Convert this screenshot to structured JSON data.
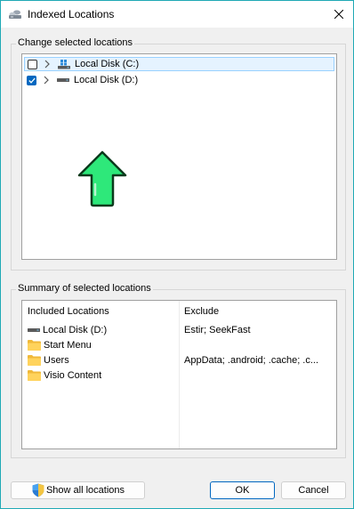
{
  "window": {
    "title": "Indexed Locations"
  },
  "change_group": {
    "label": "Change selected locations",
    "tree": [
      {
        "label": "Local Disk (C:)",
        "checked": false,
        "selected": true,
        "icon": "windows-drive-icon"
      },
      {
        "label": "Local Disk (D:)",
        "checked": true,
        "selected": false,
        "icon": "drive-icon"
      }
    ]
  },
  "summary_group": {
    "label": "Summary of selected locations",
    "headers": {
      "included": "Included Locations",
      "exclude": "Exclude"
    },
    "rows": [
      {
        "included": "Local Disk (D:)",
        "icon": "drive-icon",
        "exclude": "Estir; SeekFast"
      },
      {
        "included": "Start Menu",
        "icon": "folder-icon",
        "exclude": ""
      },
      {
        "included": "Users",
        "icon": "folder-icon",
        "exclude": "AppData; .android; .cache; .c..."
      },
      {
        "included": "Visio Content",
        "icon": "folder-icon",
        "exclude": ""
      }
    ]
  },
  "buttons": {
    "show_all": "Show all locations",
    "ok": "OK",
    "cancel": "Cancel"
  },
  "colors": {
    "accent": "#0067c0",
    "arrow": "#2ee87a",
    "background": "#00a6b4"
  }
}
